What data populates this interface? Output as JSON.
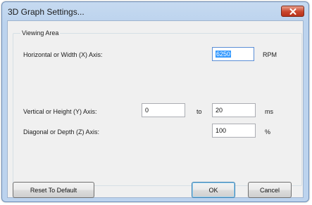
{
  "dialog": {
    "title": "3D Graph Settings...",
    "close_icon": "close-x-icon"
  },
  "viewing_area": {
    "legend": "Viewing Area",
    "horizontal": {
      "label": "Horizontal or Width (X) Axis:",
      "value": "6250",
      "unit": "RPM"
    },
    "vertical": {
      "label": "Vertical or Height (Y) Axis:",
      "from_value": "0",
      "to_label": "to",
      "to_value": "20",
      "unit": "ms"
    },
    "diagonal": {
      "label": "Diagonal or Depth (Z) Axis:",
      "value": "100",
      "unit": "%"
    }
  },
  "buttons": {
    "reset": "Reset To Default",
    "ok": "OK",
    "cancel": "Cancel"
  },
  "colors": {
    "titlebar": "#bcd3ee",
    "client_bg": "#f0f0f0",
    "close_button": "#c9452c",
    "selection": "#3399ff"
  }
}
